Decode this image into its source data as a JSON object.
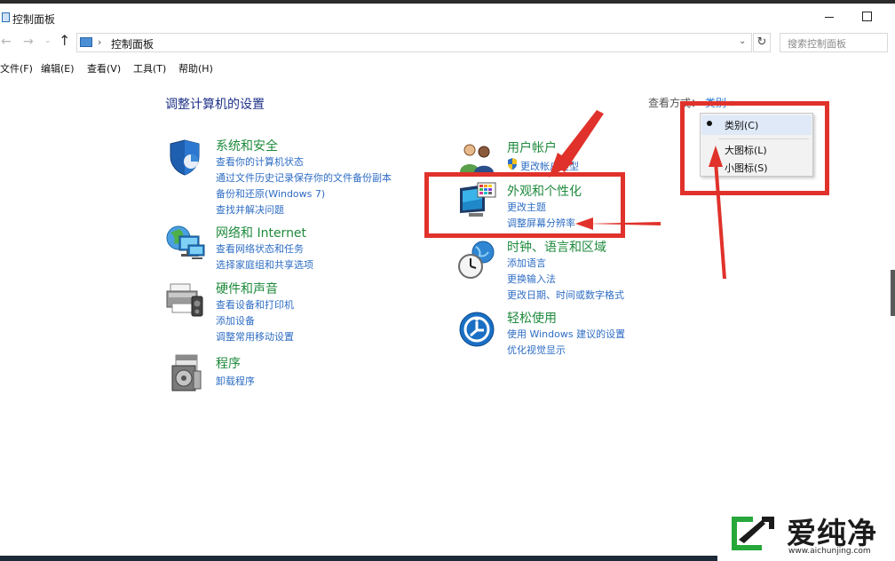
{
  "window": {
    "title": "控制面板"
  },
  "nav": {
    "back": "←",
    "forward": "→",
    "recent": "⌄",
    "up": "↑",
    "address_sep": "›",
    "address": "控制面板",
    "address_dropdown": "⌄",
    "refresh": "↻",
    "search_placeholder": "搜索控制面板"
  },
  "menu": [
    "文件(F)",
    "编辑(E)",
    "查看(V)",
    "工具(T)",
    "帮助(H)"
  ],
  "main": {
    "heading": "调整计算机的设置",
    "view_by_label": "查看方式：",
    "view_by_value": "类别 ▾"
  },
  "categories": [
    {
      "title": "系统和安全",
      "links": [
        "查看你的计算机状态",
        "通过文件历史记录保存你的文件备份副本",
        "备份和还原(Windows 7)",
        "查找并解决问题"
      ]
    },
    {
      "title": "网络和 Internet",
      "links": [
        "查看网络状态和任务",
        "选择家庭组和共享选项"
      ]
    },
    {
      "title": "硬件和声音",
      "links": [
        "查看设备和打印机",
        "添加设备",
        "调整常用移动设置"
      ]
    },
    {
      "title": "程序",
      "links": [
        "卸载程序"
      ]
    },
    {
      "title": "用户帐户",
      "links": [
        "更改帐户类型"
      ]
    },
    {
      "title": "外观和个性化",
      "links": [
        "更改主题",
        "调整屏幕分辨率"
      ]
    },
    {
      "title": "时钟、语言和区域",
      "links": [
        "添加语言",
        "更换输入法",
        "更改日期、时间或数字格式"
      ]
    },
    {
      "title": "轻松使用",
      "links": [
        "使用 Windows 建议的设置",
        "优化视觉显示"
      ]
    }
  ],
  "view_menu": {
    "items": [
      "类别(C)",
      "大图标(L)",
      "小图标(S)"
    ],
    "selected": "类别(C)"
  },
  "icons": [
    "control-panel-icon",
    "shield-icon",
    "network-globe-icon",
    "printer-icon",
    "programs-icon",
    "users-icon",
    "monitor-palette-icon",
    "clock-globe-icon",
    "ease-of-access-icon",
    "uac-shield-icon"
  ],
  "colors": {
    "link": "#2e6dc4",
    "category_title": "#1e8a3c",
    "heading": "#1e3287",
    "annotation": "#e0322b"
  },
  "watermark": {
    "title": "爱纯净",
    "url": "www.aichunjing.com"
  }
}
